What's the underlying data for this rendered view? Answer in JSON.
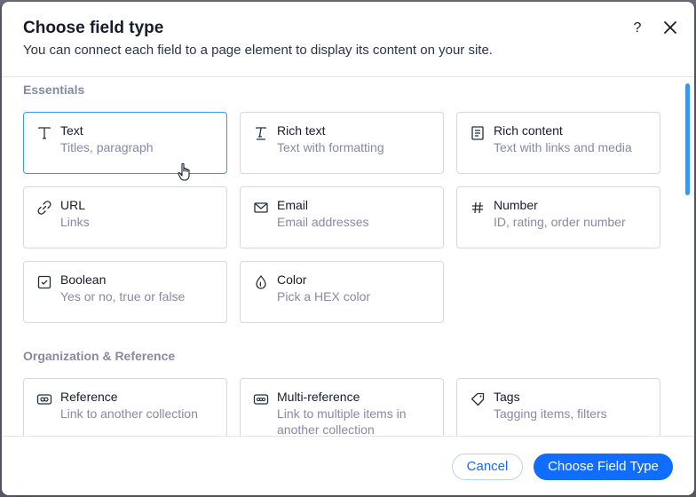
{
  "dialog": {
    "title": "Choose field type",
    "subtitle": "You can connect each field to a page element to display its content on your site.",
    "help_label": "?",
    "close_icon": "close-icon"
  },
  "sections": {
    "essentials": {
      "title": "Essentials",
      "cards": [
        {
          "label": "Text",
          "desc": "Titles, paragraph",
          "icon": "text-icon"
        },
        {
          "label": "Rich text",
          "desc": "Text with formatting",
          "icon": "rich-text-icon"
        },
        {
          "label": "Rich content",
          "desc": "Text with links and media",
          "icon": "document-icon"
        },
        {
          "label": "URL",
          "desc": "Links",
          "icon": "link-icon"
        },
        {
          "label": "Email",
          "desc": "Email addresses",
          "icon": "envelope-icon"
        },
        {
          "label": "Number",
          "desc": "ID, rating, order number",
          "icon": "hash-icon"
        },
        {
          "label": "Boolean",
          "desc": "Yes or no, true or false",
          "icon": "checkbox-icon"
        },
        {
          "label": "Color",
          "desc": "Pick a HEX color",
          "icon": "color-drop-icon"
        }
      ]
    },
    "organization": {
      "title": "Organization & Reference",
      "cards": [
        {
          "label": "Reference",
          "desc": "Link to another collection",
          "icon": "reference-icon"
        },
        {
          "label": "Multi-reference",
          "desc": "Link to multiple items in another collection",
          "icon": "multi-reference-icon"
        },
        {
          "label": "Tags",
          "desc": "Tagging items, filters",
          "icon": "tag-icon"
        }
      ]
    }
  },
  "footer": {
    "cancel_label": "Cancel",
    "primary_label": "Choose Field Type"
  },
  "colors": {
    "accent": "#116dff",
    "selected_border": "#3899ec",
    "muted_text": "#868aa5"
  }
}
